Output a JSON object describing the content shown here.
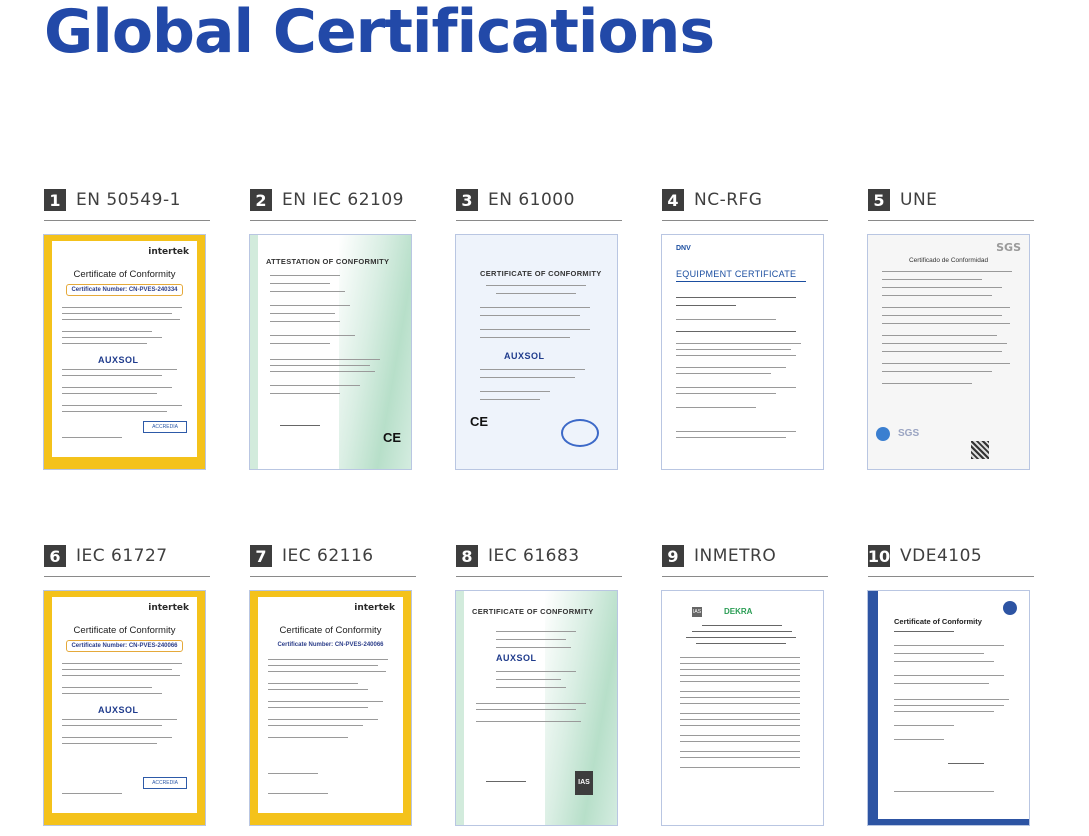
{
  "page": {
    "title": "Global Certifications"
  },
  "certificates": [
    {
      "number": "1",
      "label": "EN 50549-1"
    },
    {
      "number": "2",
      "label": "EN IEC 62109"
    },
    {
      "number": "3",
      "label": "EN 61000"
    },
    {
      "number": "4",
      "label": "NC-RFG"
    },
    {
      "number": "5",
      "label": "UNE"
    },
    {
      "number": "6",
      "label": "IEC 61727"
    },
    {
      "number": "7",
      "label": "IEC 62116"
    },
    {
      "number": "8",
      "label": "IEC 61683"
    },
    {
      "number": "9",
      "label": "INMETRO"
    },
    {
      "number": "10",
      "label": "VDE4105"
    }
  ],
  "thumbs": {
    "intertek_logo": "intertek",
    "conformity_title": "Certificate of Conformity",
    "cert_no_1": "Certificate Number: CN-PVES-240334",
    "cert_no_6": "Certificate Number: CN-PVES-240066",
    "cert_no_7": "Certificate Number: CN-PVES-240066",
    "auxsol": "AUXSOL",
    "accredia": "ACCREDIA",
    "attestation": "ATTESTATION OF CONFORMITY",
    "dekra": "DEKRA",
    "ce": "CE",
    "ce_conformity": "CERTIFICATE OF CONFORMITY",
    "equipment": "EQUIPMENT CERTIFICATE",
    "dnv": "DNV",
    "sgs": "SGS",
    "certificado": "Certificado de Conformidad",
    "ias": "IAS",
    "vde_title": "Certificate of Conformity"
  }
}
